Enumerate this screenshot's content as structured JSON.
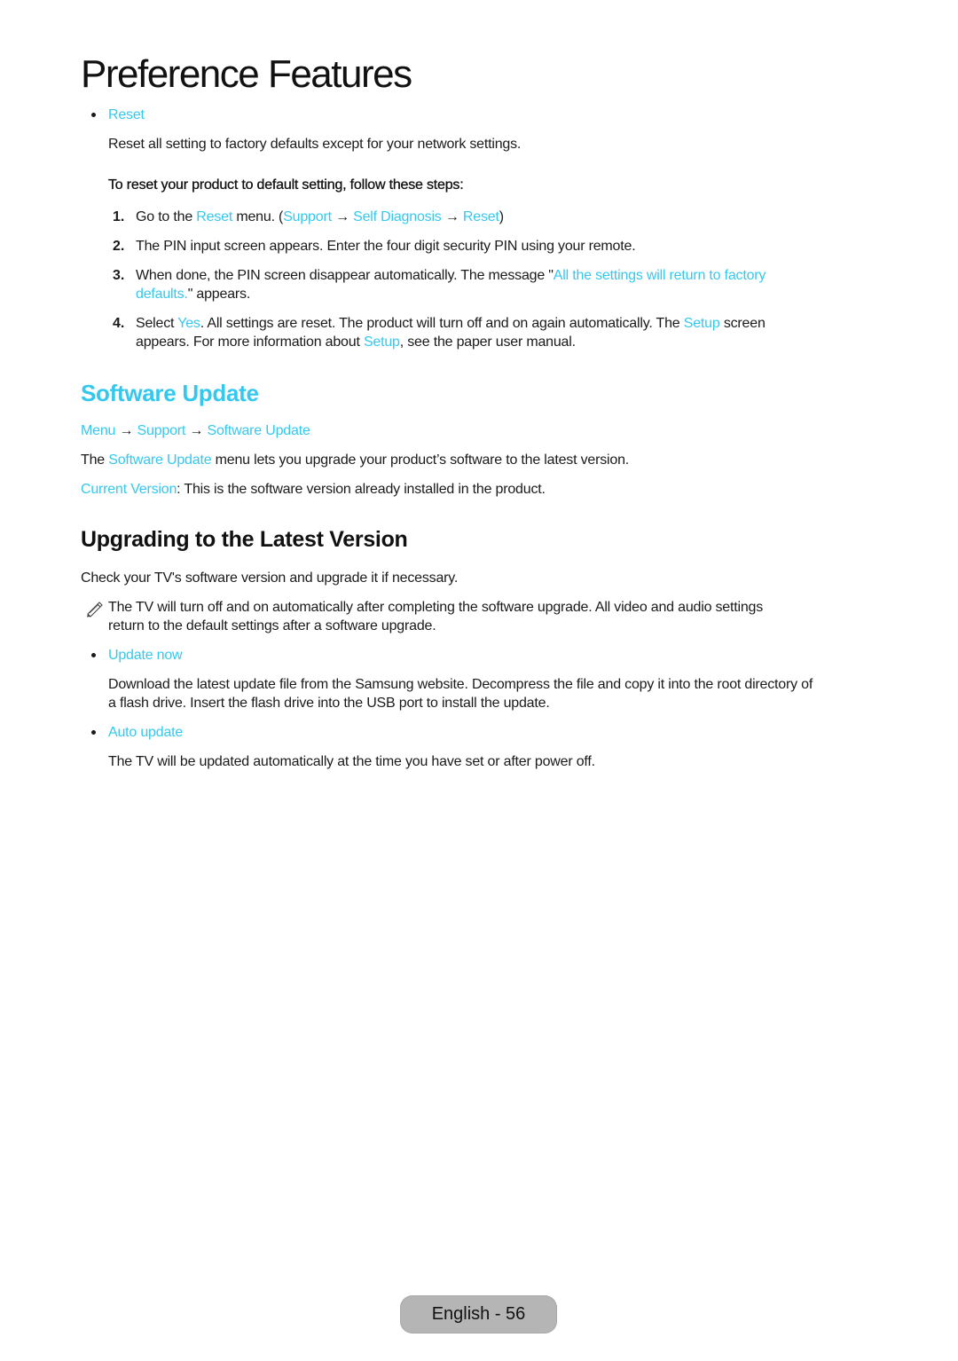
{
  "header": {
    "title": "Preference Features"
  },
  "reset_section": {
    "bullet_label": "Reset",
    "description": "Reset all setting to factory defaults except for your network settings.",
    "steps_intro": "To reset your product to default setting, follow these steps:",
    "steps": [
      {
        "number": "1.",
        "parts": [
          "Go to the ",
          "Reset",
          " menu. (",
          "Support",
          " → ",
          "Self Diagnosis",
          " → ",
          "Reset",
          ")"
        ]
      },
      {
        "number": "2.",
        "text": "The PIN input screen appears. Enter the four digit security PIN using your remote."
      },
      {
        "number": "3.",
        "line1_pre": "When done, the PIN screen disappear automatically. The message \"",
        "line1_hl": "All the settings will return to factory",
        "line2_hl": "defaults.",
        "line2_post": "\" appears."
      },
      {
        "number": "4.",
        "line1_a": "Select ",
        "line1_hl1": "Yes",
        "line1_b": ". All settings are reset. The product will turn off and on again automatically. The ",
        "line1_hl2": "Setup",
        "line1_c": " screen",
        "line2_a": "appears. For more information about ",
        "line2_hl": "Setup",
        "line2_b": ", see the paper user manual."
      }
    ]
  },
  "software_update": {
    "heading": "Software Update",
    "path": [
      "Menu",
      "Support",
      "Software Update"
    ],
    "path_separator": " → ",
    "intro_pre": "The ",
    "intro_hl": "Software Update",
    "intro_post": " menu lets you upgrade your product’s software to the latest version.",
    "current_version_label": "Current Version",
    "current_version_text": ": This is the software version already installed in the product."
  },
  "upgrading": {
    "heading": "Upgrading to the Latest Version",
    "intro": "Check your TV's software version and upgrade it if necessary.",
    "note_line1": "The TV will turn off and on automatically after completing the software upgrade. All video and audio settings",
    "note_line2": "return to the default settings after a software upgrade.",
    "update_now_label": "Update now",
    "update_now_line1": "Download the latest update file from the Samsung website. Decompress the file and copy it into the root directory of",
    "update_now_line2": "a flash drive. Insert the flash drive into the USB port to install the update.",
    "auto_update_label": "Auto update",
    "auto_update_text": "The TV will be updated automatically at the time you have set or after power off."
  },
  "footer": {
    "page_label": "English - 56"
  },
  "colors": {
    "accent": "#35c8ef",
    "text": "#1a1a1a",
    "footer_badge": "#b5b5b5"
  }
}
